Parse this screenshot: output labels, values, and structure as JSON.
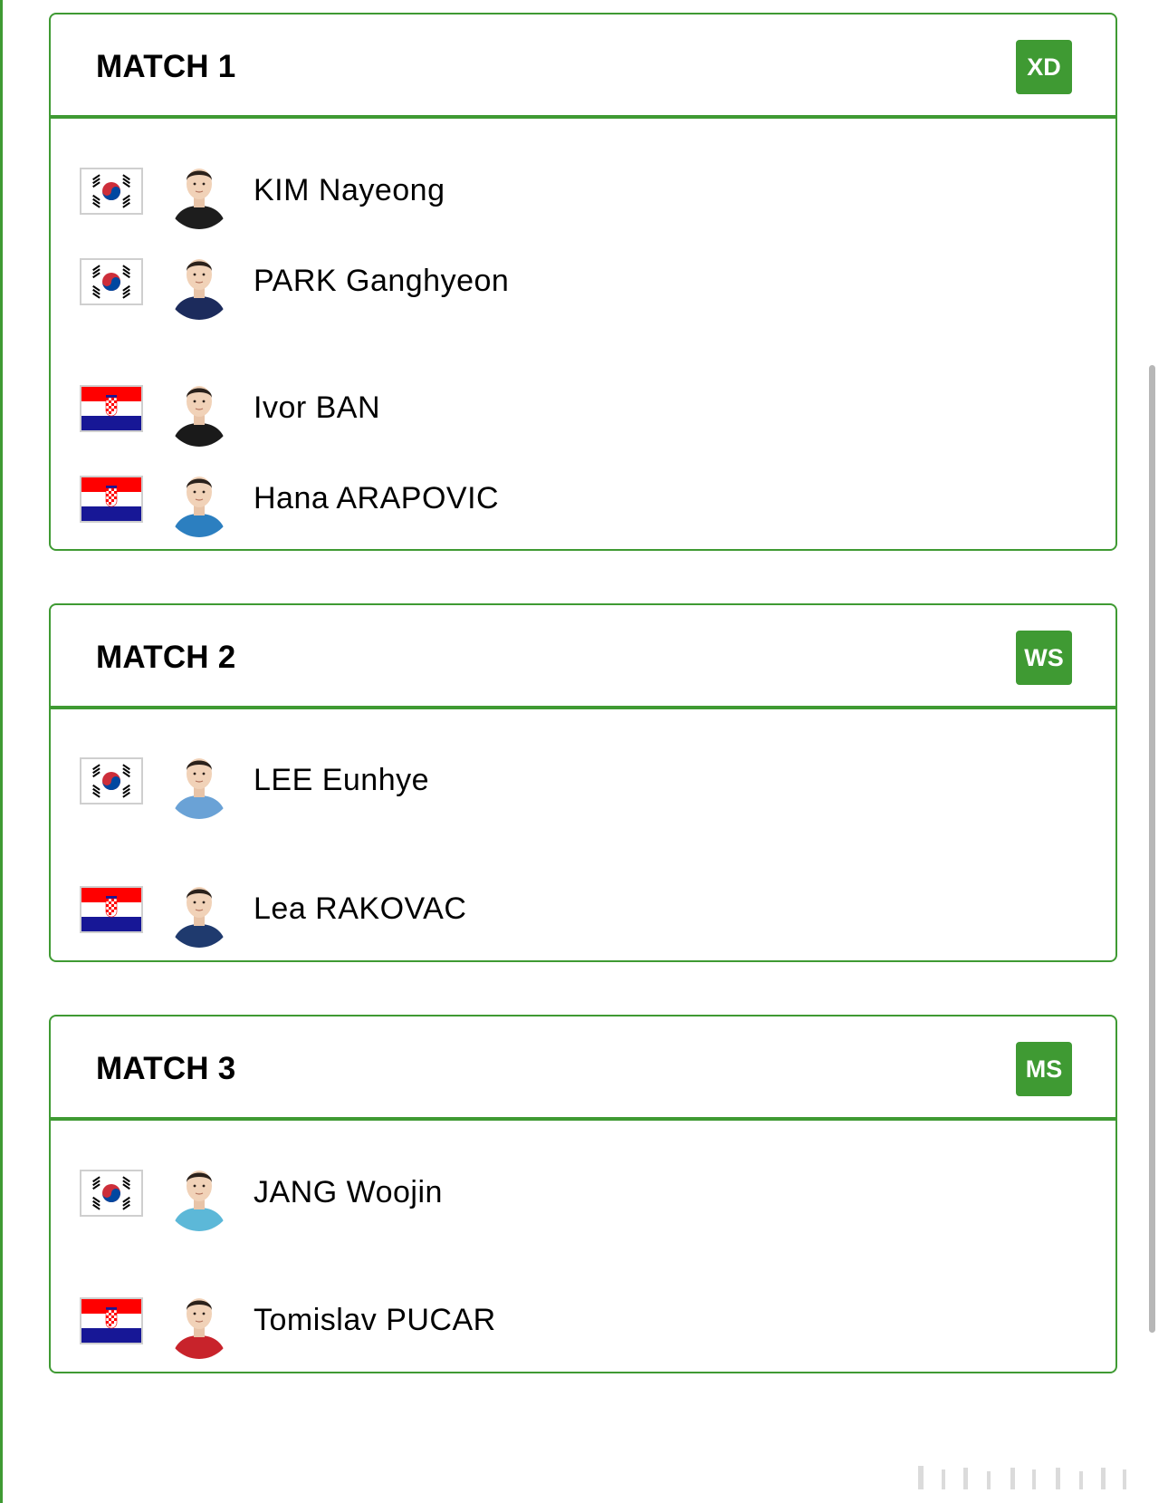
{
  "matches": [
    {
      "title": "MATCH 1",
      "badge": "XD",
      "players": [
        {
          "name": "KIM Nayeong",
          "country_flag": "korea-flag-icon",
          "shirt_color": "#1d1d1d"
        },
        {
          "name": "PARK Ganghyeon",
          "country_flag": "korea-flag-icon",
          "shirt_color": "#1c2b5c"
        },
        {
          "name": "Ivor BAN",
          "country_flag": "croatia-flag-icon",
          "shirt_color": "#1a1a1a"
        },
        {
          "name": "Hana ARAPOVIC",
          "country_flag": "croatia-flag-icon",
          "shirt_color": "#2c7fc0"
        }
      ]
    },
    {
      "title": "MATCH 2",
      "badge": "WS",
      "players": [
        {
          "name": "LEE Eunhye",
          "country_flag": "korea-flag-icon",
          "shirt_color": "#6aa2d6"
        },
        {
          "name": "Lea RAKOVAC",
          "country_flag": "croatia-flag-icon",
          "shirt_color": "#1f3a6e"
        }
      ]
    },
    {
      "title": "MATCH 3",
      "badge": "MS",
      "players": [
        {
          "name": "JANG Woojin",
          "country_flag": "korea-flag-icon",
          "shirt_color": "#5cb8d8"
        },
        {
          "name": "Tomislav PUCAR",
          "country_flag": "croatia-flag-icon",
          "shirt_color": "#c8232b"
        }
      ]
    }
  ],
  "colors": {
    "accent_green": "#3f9a33",
    "badge_text": "#ffffff"
  }
}
